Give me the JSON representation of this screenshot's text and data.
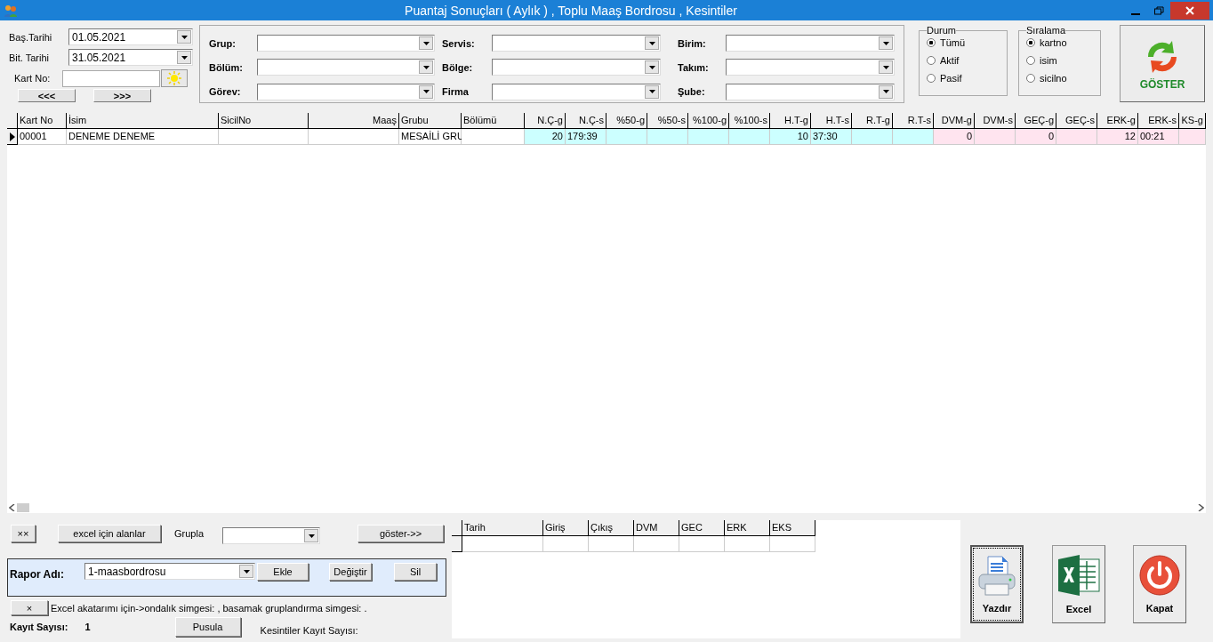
{
  "window": {
    "title": "Puantaj Sonuçları ( Aylık ) , Toplu Maaş Bordrosu , Kesintiler"
  },
  "dates": [
    {
      "label": "Baş.Tarihi",
      "value": "01.05.2021"
    },
    {
      "label": "Bit. Tarihi",
      "value": "31.05.2021"
    }
  ],
  "card_no": {
    "label": "Kart No:"
  },
  "nav_buttons": [
    "<<<",
    ">>>"
  ],
  "filters": [
    {
      "label": "Grup:"
    },
    {
      "label": "Bölüm:"
    },
    {
      "label": "Görev:"
    },
    {
      "label": "Servis:"
    },
    {
      "label": "Bölge:"
    },
    {
      "label": "Firma"
    },
    {
      "label": "Birim:"
    },
    {
      "label": "Takım:"
    },
    {
      "label": "Şube:"
    }
  ],
  "status_group": {
    "title": "Durum",
    "options": [
      {
        "label": "Tümü",
        "selected": true
      },
      {
        "label": "Aktif",
        "selected": false
      },
      {
        "label": "Pasif",
        "selected": false
      }
    ]
  },
  "sort_group": {
    "title": "Sıralama",
    "options": [
      {
        "label": "kartno",
        "selected": true
      },
      {
        "label": "isim",
        "selected": false
      },
      {
        "label": "sicilno",
        "selected": false
      }
    ]
  },
  "show_button": "GÖSTER",
  "table": {
    "columns": [
      {
        "label": "Kart No",
        "kind": "text"
      },
      {
        "label": "İsim",
        "kind": "text"
      },
      {
        "label": "SicilNo",
        "kind": "text"
      },
      {
        "label": "Maaş",
        "kind": "count"
      },
      {
        "label": "Grubu",
        "kind": "text"
      },
      {
        "label": "Bölümü",
        "kind": "text"
      },
      {
        "label": "N.Ç-g",
        "kind": "count",
        "color": "#ccffff"
      },
      {
        "label": "N.Ç-s",
        "kind": "time",
        "color": "#ccffff"
      },
      {
        "label": "%50-g",
        "kind": "count",
        "color": "#ccffff"
      },
      {
        "label": "%50-s",
        "kind": "time",
        "color": "#ccffff"
      },
      {
        "label": "%100-g",
        "kind": "count",
        "color": "#ccffff"
      },
      {
        "label": "%100-s",
        "kind": "time",
        "color": "#ccffff"
      },
      {
        "label": "H.T-g",
        "kind": "count",
        "color": "#ccffff"
      },
      {
        "label": "H.T-s",
        "kind": "time",
        "color": "#ccffff"
      },
      {
        "label": "R.T-g",
        "kind": "count",
        "color": "#ccffff"
      },
      {
        "label": "R.T-s",
        "kind": "time",
        "color": "#ccffff"
      },
      {
        "label": "DVM-g",
        "kind": "count",
        "color": "#ffe4ef"
      },
      {
        "label": "DVM-s",
        "kind": "time",
        "color": "#ffe4ef"
      },
      {
        "label": "GEÇ-g",
        "kind": "count",
        "color": "#ffe4ef"
      },
      {
        "label": "GEÇ-s",
        "kind": "time",
        "color": "#ffe4ef"
      },
      {
        "label": "ERK-g",
        "kind": "count",
        "color": "#ffe4ef"
      },
      {
        "label": "ERK-s",
        "kind": "time",
        "color": "#ffe4ef"
      },
      {
        "label": "KS-g",
        "kind": "count",
        "color": "#ffe4ef"
      }
    ],
    "rows": [
      {
        "selected": true,
        "cells": [
          "00001",
          "DENEME DENEME",
          "",
          "",
          "MESAİLİ GRU",
          "",
          "20",
          "179:39",
          "",
          "",
          "",
          "",
          "10",
          "37:30",
          "",
          "",
          "0",
          "",
          "0",
          "",
          "12",
          "00:21",
          ""
        ]
      }
    ]
  },
  "toolbar": {
    "small_button": "××",
    "fields_button": "excel için alanlar",
    "group_label": "Grupla",
    "show_more_button": "göster->>"
  },
  "report": {
    "label": "Rapor Adı:",
    "value": "1-maasbordrosu",
    "buttons": [
      "Ekle",
      "Değiştir",
      "Sil"
    ]
  },
  "excel_note": {
    "button": "×",
    "text": "Excel akatarımı için->ondalık simgesi: ,  basamak gruplandırma simgesi: ."
  },
  "record_count": {
    "label": "Kayıt Sayısı:",
    "value": "1"
  },
  "slip_button": "Pusula",
  "deductions_count": {
    "label": "Kesintiler Kayıt Sayısı:"
  },
  "detail_table": {
    "columns": [
      "Tarih",
      "Giriş",
      "Çıkış",
      "DVM",
      "GEC",
      "ERK",
      "EKS"
    ]
  },
  "actions": [
    {
      "kind": "print",
      "label": "Yazdır"
    },
    {
      "kind": "excel",
      "label": "Excel"
    },
    {
      "kind": "power",
      "label": "Kapat"
    }
  ]
}
